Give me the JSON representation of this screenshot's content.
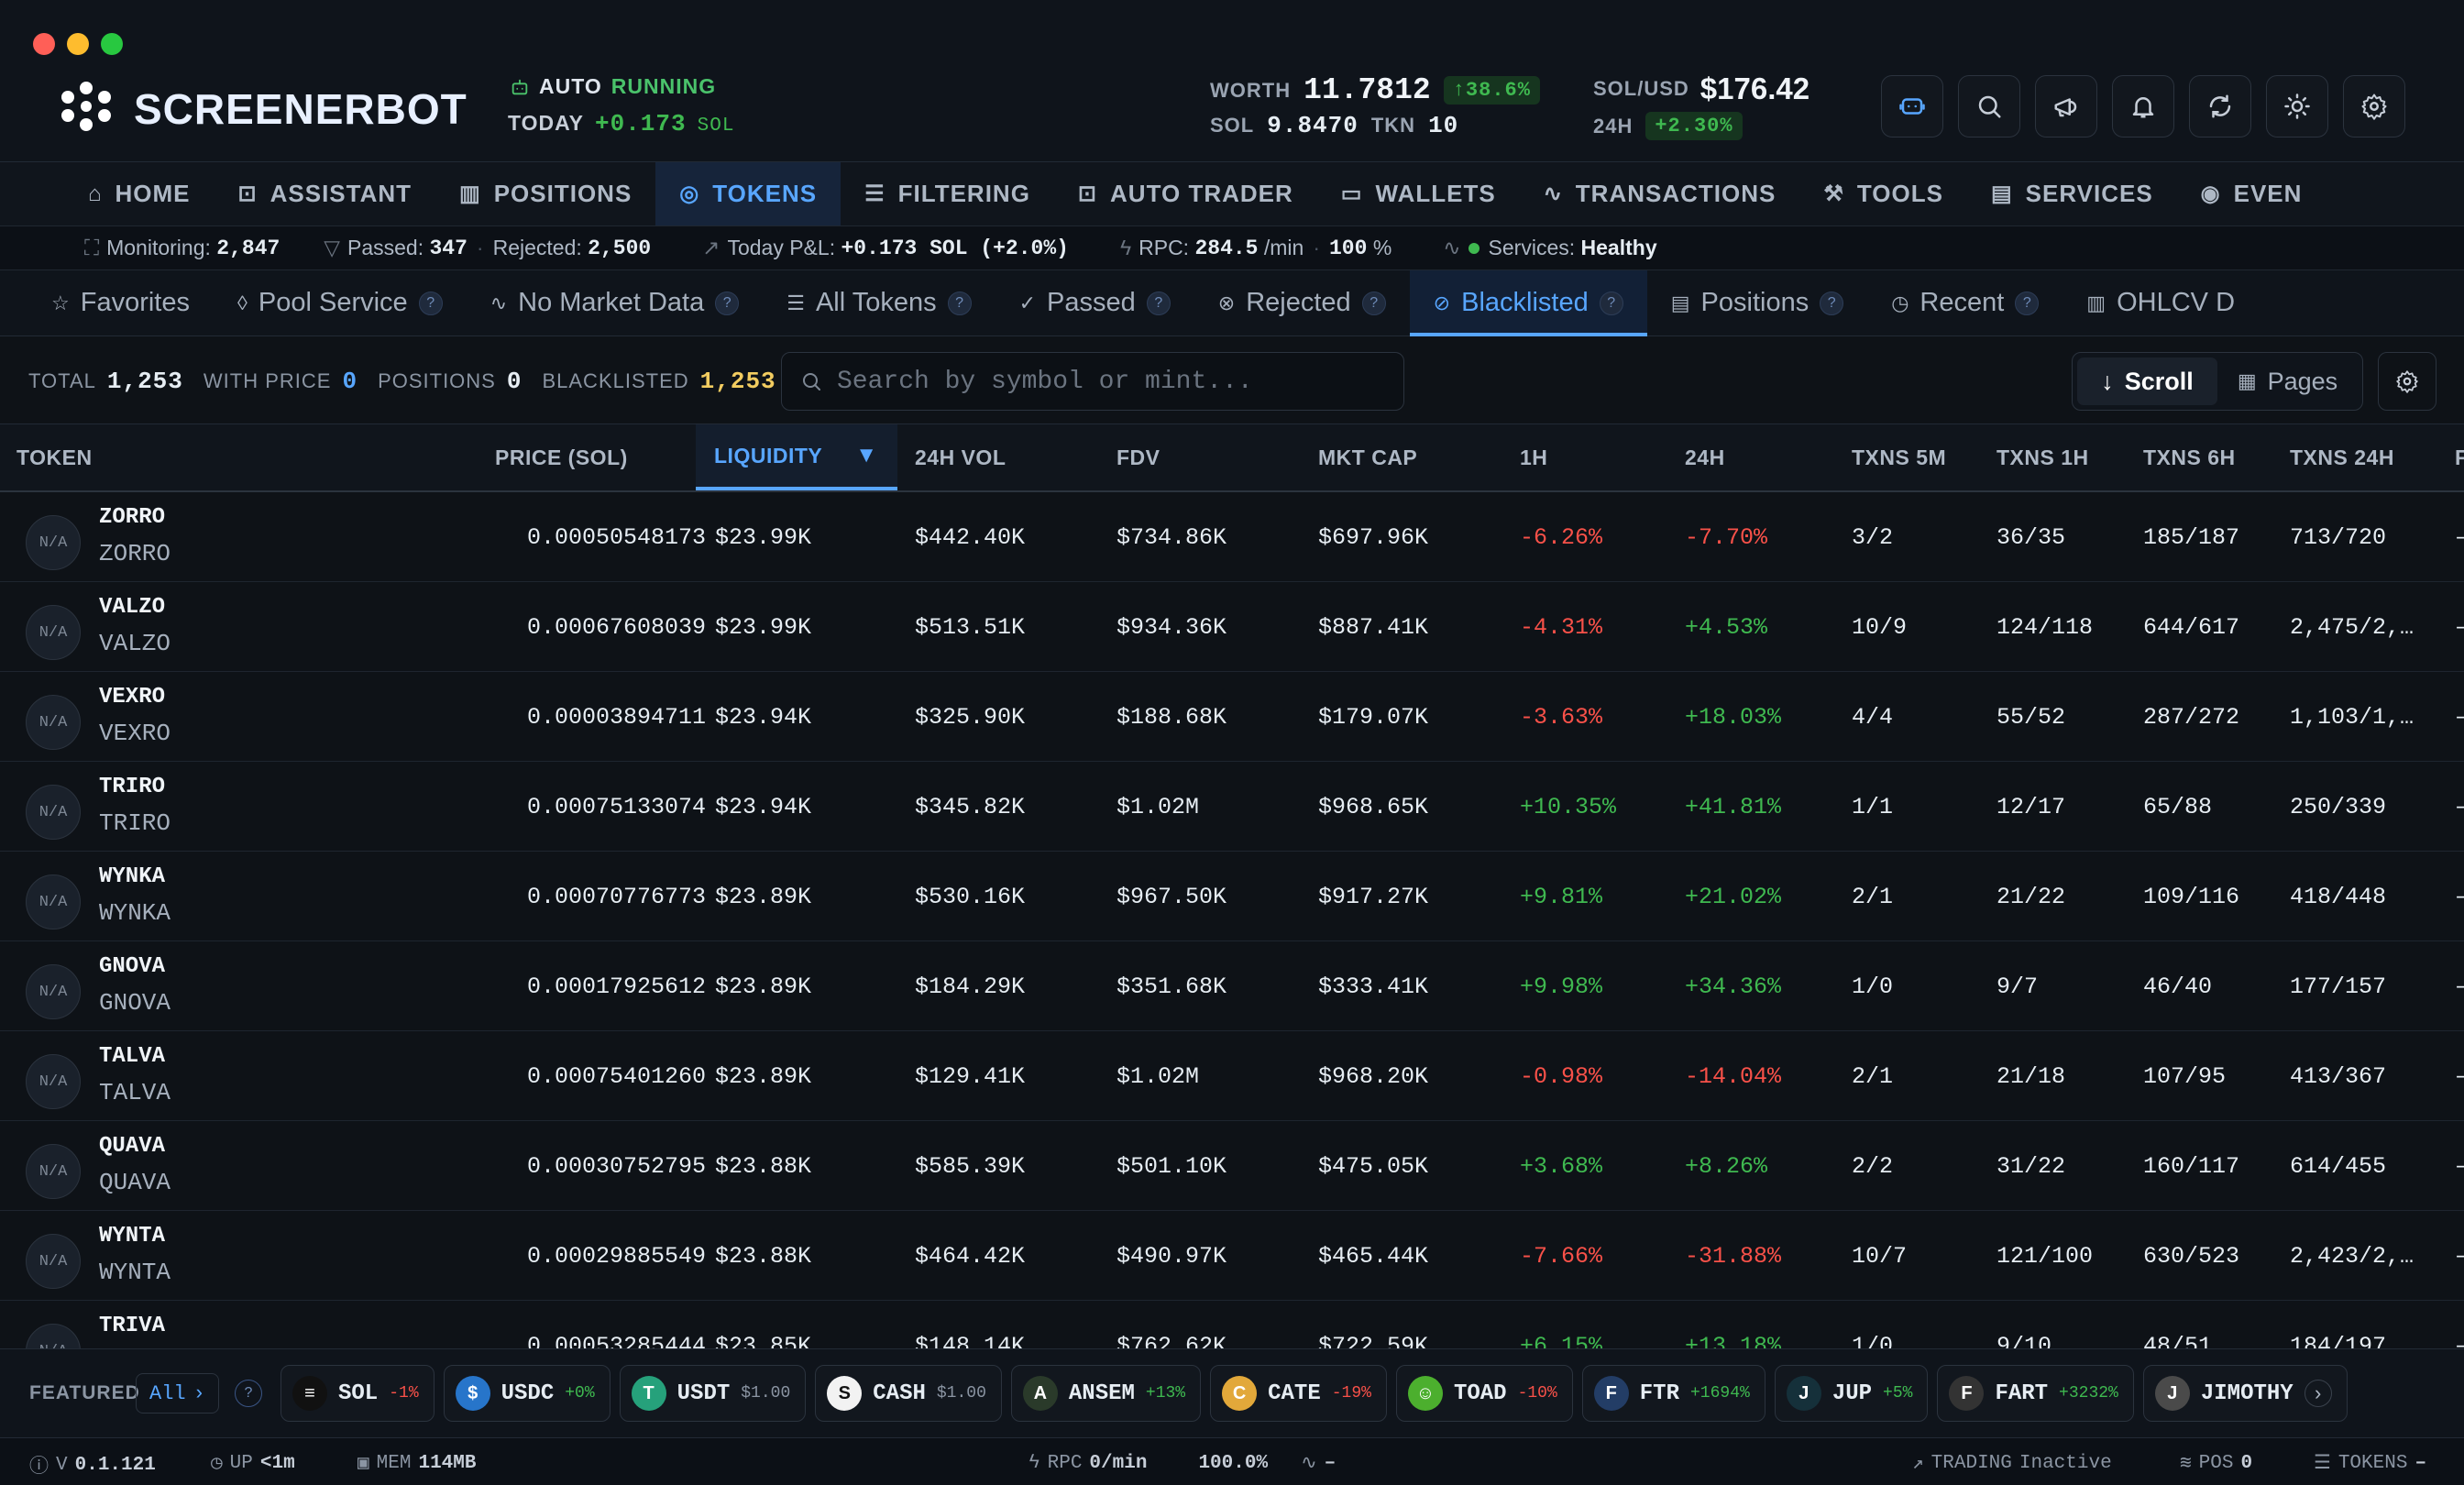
{
  "app": {
    "name": "SCREENERBOT"
  },
  "auto": {
    "label": "AUTO",
    "status": "RUNNING",
    "today_label": "TODAY",
    "today_value": "+0.173",
    "today_unit": "SOL"
  },
  "wallet": {
    "worth_label": "WORTH",
    "worth_value": "11.7812",
    "worth_change": "↑38.6%",
    "sol_label": "SOL",
    "sol_value": "9.8470",
    "tkn_label": "TKN",
    "tkn_value": "10"
  },
  "price": {
    "pair_label": "SOL/USD",
    "pair_value": "$176.42",
    "change_label": "24H",
    "change_value": "+2.30%"
  },
  "colors": {
    "accent": "#58a6ff",
    "positive": "#3fb950",
    "negative": "#f85149",
    "warning": "#f2cc60",
    "background": "#0e1217"
  },
  "header_buttons": [
    "assistant-icon",
    "search-icon",
    "megaphone-icon",
    "bell-icon",
    "refresh-icon",
    "sun-icon",
    "gear-icon"
  ],
  "nav": [
    {
      "label": "HOME",
      "icon": "home-icon"
    },
    {
      "label": "ASSISTANT",
      "icon": "bot-icon"
    },
    {
      "label": "POSITIONS",
      "icon": "chart-icon"
    },
    {
      "label": "TOKENS",
      "icon": "coins-icon",
      "active": true
    },
    {
      "label": "FILTERING",
      "icon": "filter-icon"
    },
    {
      "label": "AUTO TRADER",
      "icon": "bot-icon"
    },
    {
      "label": "WALLETS",
      "icon": "wallet-icon"
    },
    {
      "label": "TRANSACTIONS",
      "icon": "activity-icon"
    },
    {
      "label": "TOOLS",
      "icon": "wrench-icon"
    },
    {
      "label": "SERVICES",
      "icon": "server-icon"
    },
    {
      "label": "EVEN",
      "icon": "radio-icon"
    }
  ],
  "statusbar": {
    "monitoring_label": "Monitoring:",
    "monitoring_value": "2,847",
    "passed_label": "Passed:",
    "passed_value": "347",
    "rejected_label": "Rejected:",
    "rejected_value": "2,500",
    "pnl_label": "Today P&L:",
    "pnl_value": "+0.173 SOL (+2.0%)",
    "rpc_label": "RPC:",
    "rpc_value": "284.5",
    "rpc_unit": "/min",
    "rpc_pct": "100",
    "rpc_pct_unit": "%",
    "services_label": "Services:",
    "services_value": "Healthy"
  },
  "tabs": [
    {
      "label": "Favorites",
      "icon": "star-icon",
      "help": false
    },
    {
      "label": "Pool Service",
      "icon": "droplet-icon",
      "help": true
    },
    {
      "label": "No Market Data",
      "icon": "trend-icon",
      "help": true
    },
    {
      "label": "All Tokens",
      "icon": "list-icon",
      "help": true
    },
    {
      "label": "Passed",
      "icon": "check-icon",
      "help": true
    },
    {
      "label": "Rejected",
      "icon": "x-circle-icon",
      "help": true
    },
    {
      "label": "Blacklisted",
      "icon": "ban-icon",
      "help": true,
      "active": true
    },
    {
      "label": "Positions",
      "icon": "bars-icon",
      "help": true
    },
    {
      "label": "Recent",
      "icon": "clock-icon",
      "help": true
    },
    {
      "label": "OHLCV D",
      "icon": "candle-icon",
      "help": false
    }
  ],
  "toolbar": {
    "total_label": "TOTAL",
    "total_value": "1,253",
    "with_price_label": "WITH PRICE",
    "with_price_value": "0",
    "positions_label": "POSITIONS",
    "positions_value": "0",
    "blacklisted_label": "BLACKLISTED",
    "blacklisted_value": "1,253",
    "search_placeholder": "Search by symbol or mint...",
    "scroll_label": "Scroll",
    "pages_label": "Pages"
  },
  "columns": [
    "TOKEN",
    "PRICE (SOL)",
    "LIQUIDITY",
    "24H VOL",
    "FDV",
    "MKT CAP",
    "1H",
    "24H",
    "TXNS 5M",
    "TXNS 1H",
    "TXNS 6H",
    "TXNS 24H",
    "F"
  ],
  "sort": {
    "column": "LIQUIDITY",
    "direction": "desc"
  },
  "rows": [
    {
      "avatar": "N/A",
      "symbol": "ZORRO",
      "name": "ZORRO",
      "price": "0.00050548173",
      "liquidity": "$23.99K",
      "vol": "$442.40K",
      "fdv": "$734.86K",
      "mcap": "$697.96K",
      "h1": "-6.26%",
      "h24": "-7.70%",
      "t5m": "3/2",
      "t1h": "36/35",
      "t6h": "185/187",
      "t24h": "713/720",
      "extra": "–"
    },
    {
      "avatar": "N/A",
      "symbol": "VALZO",
      "name": "VALZO",
      "price": "0.00067608039",
      "liquidity": "$23.99K",
      "vol": "$513.51K",
      "fdv": "$934.36K",
      "mcap": "$887.41K",
      "h1": "-4.31%",
      "h24": "+4.53%",
      "t5m": "10/9",
      "t1h": "124/118",
      "t6h": "644/617",
      "t24h": "2,475/2,…",
      "extra": "–"
    },
    {
      "avatar": "N/A",
      "symbol": "VEXRO",
      "name": "VEXRO",
      "price": "0.00003894711",
      "liquidity": "$23.94K",
      "vol": "$325.90K",
      "fdv": "$188.68K",
      "mcap": "$179.07K",
      "h1": "-3.63%",
      "h24": "+18.03%",
      "t5m": "4/4",
      "t1h": "55/52",
      "t6h": "287/272",
      "t24h": "1,103/1,…",
      "extra": "–"
    },
    {
      "avatar": "N/A",
      "symbol": "TRIRO",
      "name": "TRIRO",
      "price": "0.00075133074",
      "liquidity": "$23.94K",
      "vol": "$345.82K",
      "fdv": "$1.02M",
      "mcap": "$968.65K",
      "h1": "+10.35%",
      "h24": "+41.81%",
      "t5m": "1/1",
      "t1h": "12/17",
      "t6h": "65/88",
      "t24h": "250/339",
      "extra": "–"
    },
    {
      "avatar": "N/A",
      "symbol": "WYNKA",
      "name": "WYNKA",
      "price": "0.00070776773",
      "liquidity": "$23.89K",
      "vol": "$530.16K",
      "fdv": "$967.50K",
      "mcap": "$917.27K",
      "h1": "+9.81%",
      "h24": "+21.02%",
      "t5m": "2/1",
      "t1h": "21/22",
      "t6h": "109/116",
      "t24h": "418/448",
      "extra": "–"
    },
    {
      "avatar": "N/A",
      "symbol": "GNOVA",
      "name": "GNOVA",
      "price": "0.00017925612",
      "liquidity": "$23.89K",
      "vol": "$184.29K",
      "fdv": "$351.68K",
      "mcap": "$333.41K",
      "h1": "+9.98%",
      "h24": "+34.36%",
      "t5m": "1/0",
      "t1h": "9/7",
      "t6h": "46/40",
      "t24h": "177/157",
      "extra": "–"
    },
    {
      "avatar": "N/A",
      "symbol": "TALVA",
      "name": "TALVA",
      "price": "0.00075401260",
      "liquidity": "$23.89K",
      "vol": "$129.41K",
      "fdv": "$1.02M",
      "mcap": "$968.20K",
      "h1": "-0.98%",
      "h24": "-14.04%",
      "t5m": "2/1",
      "t1h": "21/18",
      "t6h": "107/95",
      "t24h": "413/367",
      "extra": "–"
    },
    {
      "avatar": "N/A",
      "symbol": "QUAVA",
      "name": "QUAVA",
      "price": "0.00030752795",
      "liquidity": "$23.88K",
      "vol": "$585.39K",
      "fdv": "$501.10K",
      "mcap": "$475.05K",
      "h1": "+3.68%",
      "h24": "+8.26%",
      "t5m": "2/2",
      "t1h": "31/22",
      "t6h": "160/117",
      "t24h": "614/455",
      "extra": "–"
    },
    {
      "avatar": "N/A",
      "symbol": "WYNTA",
      "name": "WYNTA",
      "price": "0.00029885549",
      "liquidity": "$23.88K",
      "vol": "$464.42K",
      "fdv": "$490.97K",
      "mcap": "$465.44K",
      "h1": "-7.66%",
      "h24": "-31.88%",
      "t5m": "10/7",
      "t1h": "121/100",
      "t6h": "630/523",
      "t24h": "2,423/2,…",
      "extra": "–"
    },
    {
      "avatar": "N/A",
      "symbol": "TRIVA",
      "name": "TRIVA",
      "price": "0.00053285444",
      "liquidity": "$23.85K",
      "vol": "$148.14K",
      "fdv": "$762.62K",
      "mcap": "$722.59K",
      "h1": "+6.15%",
      "h24": "+13.18%",
      "t5m": "1/0",
      "t1h": "9/10",
      "t6h": "48/51",
      "t24h": "184/197",
      "extra": "–"
    }
  ],
  "featured": {
    "label": "FEATURED",
    "filter": "All",
    "tokens": [
      {
        "symbol": "SOL",
        "change": "-1%",
        "tone": "neg",
        "color": "#111",
        "glyph": "≡",
        "icon": "solana-icon"
      },
      {
        "symbol": "USDC",
        "change": "+0%",
        "tone": "pos",
        "color": "#2775ca",
        "glyph": "$",
        "icon": "usdc-icon"
      },
      {
        "symbol": "USDT",
        "change": "$1.00",
        "tone": "neutral",
        "color": "#26a17b",
        "glyph": "T",
        "icon": "usdt-icon"
      },
      {
        "symbol": "CASH",
        "change": "$1.00",
        "tone": "neutral",
        "color": "#f2f2f2",
        "glyph": "S",
        "icon": "cash-icon"
      },
      {
        "symbol": "ANSEM",
        "change": "+13%",
        "tone": "pos",
        "color": "#2a3a2a",
        "glyph": "A",
        "icon": "ansem-icon"
      },
      {
        "symbol": "CATE",
        "change": "-19%",
        "tone": "neg",
        "color": "#e2a83a",
        "glyph": "C",
        "icon": "cate-icon"
      },
      {
        "symbol": "TOAD",
        "change": "-10%",
        "tone": "neg",
        "color": "#4caf2e",
        "glyph": "☺",
        "icon": "toad-icon"
      },
      {
        "symbol": "FTR",
        "change": "+1694%",
        "tone": "pos",
        "color": "#233d66",
        "glyph": "F",
        "icon": "ftr-icon"
      },
      {
        "symbol": "JUP",
        "change": "+5%",
        "tone": "pos",
        "color": "#15303a",
        "glyph": "J",
        "icon": "jup-icon"
      },
      {
        "symbol": "FART",
        "change": "+3232%",
        "tone": "pos",
        "color": "#333",
        "glyph": "F",
        "icon": "fart-icon"
      },
      {
        "symbol": "JIMOTHY",
        "change": "",
        "tone": "neutral",
        "color": "#4a4a4a",
        "glyph": "J",
        "icon": "jimothy-icon"
      }
    ]
  },
  "footer": {
    "version_label": "V",
    "version": "0.1.121",
    "up_label": "UP",
    "up_value": "<1m",
    "mem_label": "MEM",
    "mem_value": "114MB",
    "rpc_label": "RPC",
    "rpc_value": "0/min",
    "rpc_pct": "100.0%",
    "pulse": "–",
    "trading_label": "TRADING",
    "trading_value": "Inactive",
    "pos_label": "POS",
    "pos_value": "0",
    "tokens_label": "TOKENS",
    "tokens_value": "–"
  }
}
